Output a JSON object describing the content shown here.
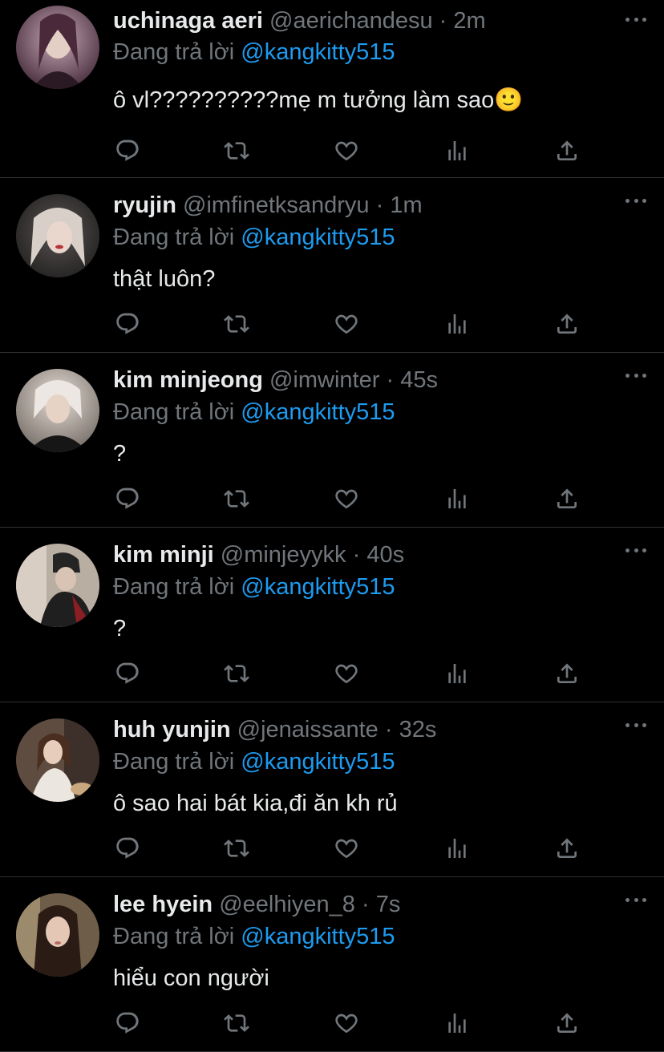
{
  "reply_prefix": "Đang trả lời",
  "tweets": [
    {
      "name": "uchinaga aeri",
      "handle": "@aerichandesu",
      "dot": "·",
      "time": "2m",
      "reply_to": "@kangkitty515",
      "text": "ô vl??????????mẹ m tưởng làm sao🙂",
      "avatar_colors": [
        "#c7a9b6",
        "#3a2030"
      ]
    },
    {
      "name": "ryujin",
      "handle": "@imfinetksandryu",
      "dot": "·",
      "time": "1m",
      "reply_to": "@kangkitty515",
      "text": "thật luôn?",
      "avatar_colors": [
        "#3a3a3a",
        "#d9cfc9"
      ]
    },
    {
      "name": "kim minjeong",
      "handle": "@imwinter",
      "dot": "·",
      "time": "45s",
      "reply_to": "@kangkitty515",
      "text": "?",
      "avatar_colors": [
        "#d8d0c8",
        "#1c1c1c"
      ]
    },
    {
      "name": "kim minji",
      "handle": "@minjeyykk",
      "dot": "·",
      "time": "40s",
      "reply_to": "@kangkitty515",
      "text": "?",
      "avatar_colors": [
        "#bfb2a4",
        "#2a2a2a"
      ]
    },
    {
      "name": "huh yunjin",
      "handle": "@jenaissante",
      "dot": "·",
      "time": "32s",
      "reply_to": "@kangkitty515",
      "text": "ô sao hai bát kia,đi ăn kh rủ",
      "avatar_colors": [
        "#6b5a4e",
        "#e9ded4"
      ]
    },
    {
      "name": "lee hyein",
      "handle": "@eelhiyen_8",
      "dot": "·",
      "time": "7s",
      "reply_to": "@kangkitty515",
      "text": "hiểu con người",
      "avatar_colors": [
        "#7a6a55",
        "#2a1e16"
      ]
    }
  ],
  "icons": {
    "reply": "reply-icon",
    "retweet": "retweet-icon",
    "like": "like-icon",
    "views": "views-icon",
    "share": "share-icon",
    "more": "more-icon"
  },
  "colors": {
    "background": "#000000",
    "text": "#e7e9ea",
    "muted": "#71767b",
    "link": "#1d9bf0",
    "divider": "#2f3336"
  }
}
